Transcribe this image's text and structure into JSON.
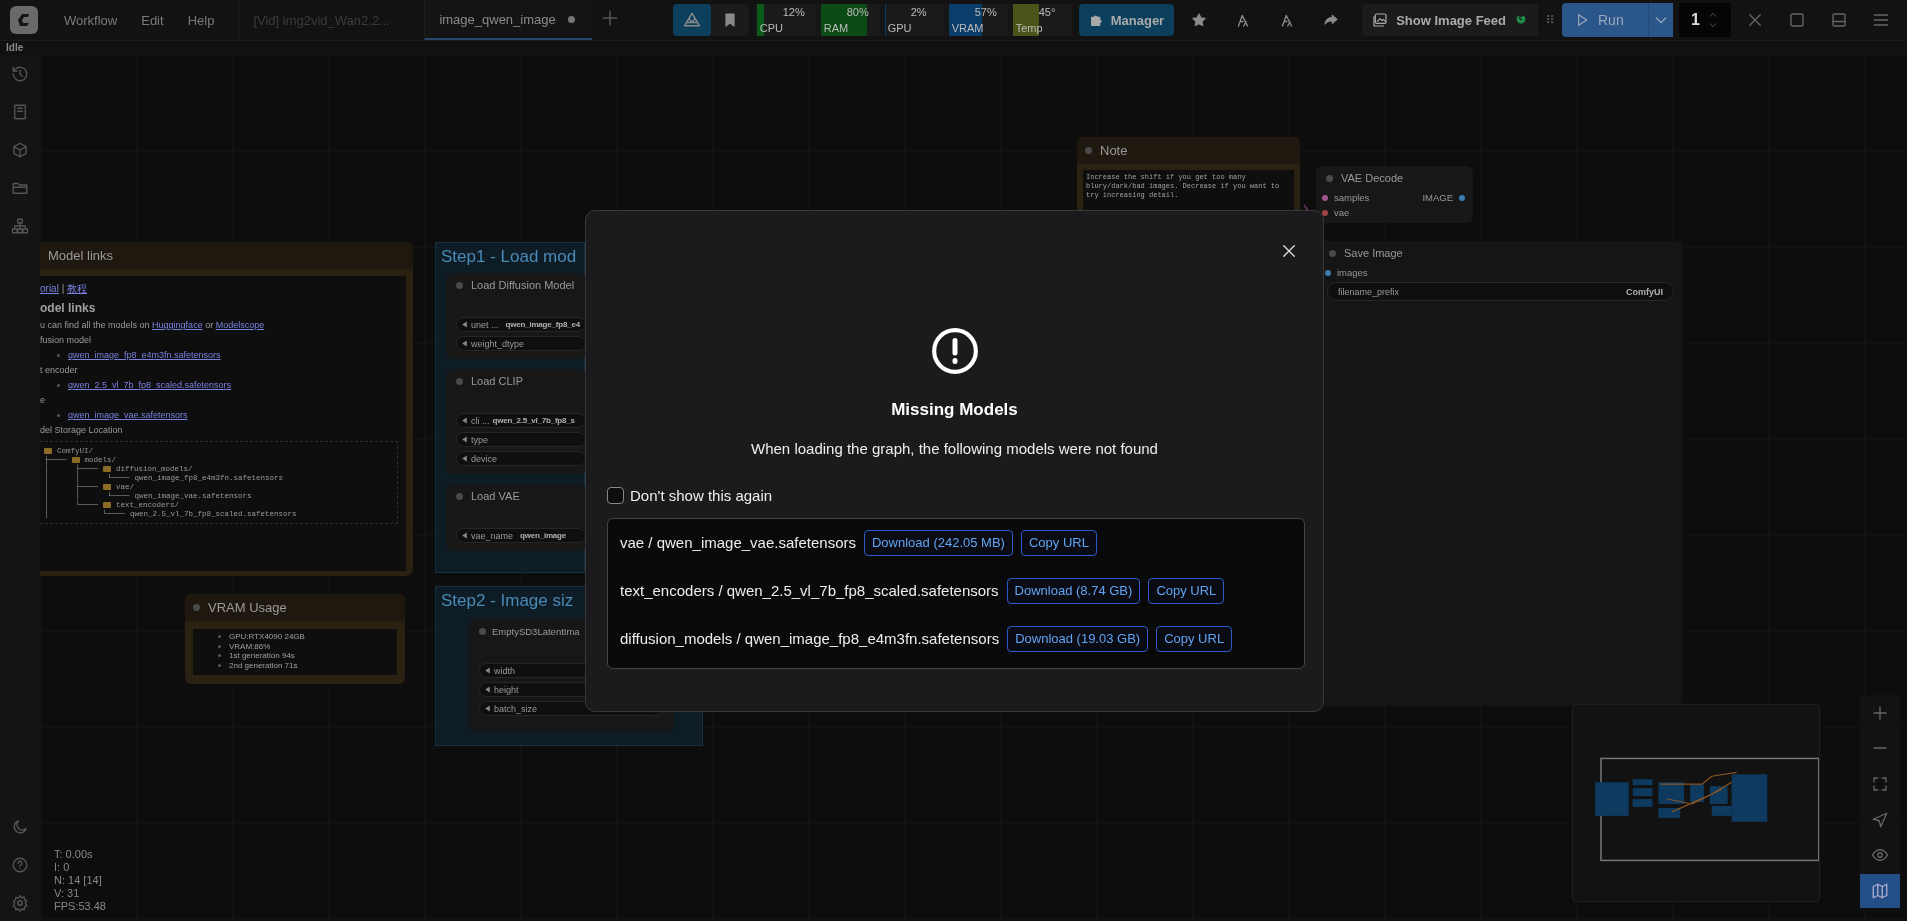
{
  "topbar": {
    "menus": [
      "Workflow",
      "Edit",
      "Help"
    ],
    "tabs": [
      {
        "label": "[Vid] img2vid_Wan2.2...",
        "selected": false,
        "unsaved": false
      },
      {
        "label": "image_qwen_image",
        "selected": true,
        "unsaved": true
      }
    ],
    "monitors": [
      {
        "label": "CPU",
        "value": "12%",
        "level": 0.12,
        "color": "#0c5a18"
      },
      {
        "label": "RAM",
        "value": "80%",
        "level": 0.8,
        "color": "#0a4a14"
      },
      {
        "label": "GPU",
        "value": "2%",
        "level": 0.02,
        "color": "#0b3d6a"
      },
      {
        "label": "VRAM",
        "value": "57%",
        "level": 0.57,
        "color": "#0b3d6a"
      },
      {
        "label": "Temp",
        "value": "45°",
        "level": 0.45,
        "color": "#4a5418"
      }
    ],
    "manager": "Manager",
    "image_feed": "Show Image Feed",
    "run": "Run",
    "batch_count": "1"
  },
  "status": "Idle",
  "model_links_node": {
    "title": "Model links",
    "body": [
      {
        "kind": "links",
        "links": [
          "orial",
          "教程"
        ],
        "separator": "|"
      },
      {
        "kind": "heading",
        "text": "odel links"
      },
      {
        "kind": "paragraph",
        "text": "u can find all the models on",
        "links": [
          "Huggingface",
          "Modelscope"
        ],
        "joiner": "or"
      },
      {
        "kind": "label",
        "text": "fusion model"
      },
      {
        "kind": "bullet",
        "text": "qwen_image_fp8_e4m3fn.safetensors"
      },
      {
        "kind": "label",
        "text": "t encoder"
      },
      {
        "kind": "bullet",
        "text": "qwen_2.5_vl_7b_fp8_scaled.safetensors"
      },
      {
        "kind": "label",
        "text": "e"
      },
      {
        "kind": "bullet",
        "text": "qwen_image_vae.safetensors"
      },
      {
        "kind": "label",
        "text": "del Storage Location"
      },
      {
        "kind": "tree",
        "lines": [
          {
            "folder": true,
            "name": "ComfyUI/"
          },
          {
            "branch": "├────",
            "folder": true,
            "name": "models/"
          },
          {
            "branch": "│      ├────",
            "folder": true,
            "name": "diffusion_models/"
          },
          {
            "branch": "│      │      └────",
            "folder": false,
            "name": "qwen_image_fp8_e4m3fn.safetensors"
          },
          {
            "branch": "│      ├────",
            "folder": true,
            "name": "vae/"
          },
          {
            "branch": "│      │      └────",
            "folder": false,
            "name": "qwen_image_vae.safetensors"
          },
          {
            "branch": "│      └────",
            "folder": true,
            "name": "text_encoders/"
          },
          {
            "branch": "│            └────",
            "folder": false,
            "name": "qwen_2.5_vl_7b_fp8_scaled.safetensors"
          }
        ]
      }
    ]
  },
  "groups": [
    {
      "title": "Step1 - Load mod",
      "nodes": [
        {
          "title": "Load Diffusion Model",
          "widgets": [
            {
              "label": "unet ...",
              "value": "qwen_image_fp8_e4"
            },
            {
              "label": "weight_dtype"
            }
          ]
        },
        {
          "title": "Load CLIP",
          "widgets": [
            {
              "label": "cli ...",
              "value": "qwen_2.5_vl_7b_fp8_s"
            },
            {
              "label": "type"
            },
            {
              "label": "device"
            }
          ]
        },
        {
          "title": "Load VAE",
          "widgets": [
            {
              "label": "vae_name",
              "value": "qwen_image"
            }
          ]
        }
      ]
    },
    {
      "title": "Step2 - Image siz",
      "nodes": [
        {
          "title": "EmptySD3LatentIma",
          "widgets": [
            {
              "label": "width"
            },
            {
              "label": "height"
            },
            {
              "label": "batch_size"
            }
          ]
        }
      ]
    }
  ],
  "vram_node": {
    "title": "VRAM Usage",
    "items": [
      "GPU:RTX4090 24GB",
      "VRAM:86%",
      "1st generation 94s",
      "2nd generation 71s"
    ]
  },
  "note_node": {
    "title": "Note",
    "text": "Increase the shift if you get too many blury/dark/bad images. Decrease if you want to try increasing detail."
  },
  "vae_decode_node": {
    "title": "VAE Decode",
    "inputs": [
      {
        "label": "samples",
        "color": "#a0558c"
      },
      {
        "label": "vae",
        "color": "#a04444"
      }
    ],
    "outputs": [
      {
        "label": "IMAGE",
        "color": "#3a7cae"
      }
    ]
  },
  "save_image_node": {
    "title": "Save Image",
    "inputs": [
      {
        "label": "images",
        "color": "#3a7cae"
      }
    ],
    "widgets": [
      {
        "label": "filename_prefix",
        "value": "ComfyUI"
      }
    ]
  },
  "stats": [
    "T: 0.00s",
    "I: 0",
    "N: 14 [14]",
    "V: 31",
    "FPS:53.48"
  ],
  "canvas_controls": [
    {
      "kind": "zoom_in",
      "selected": false
    },
    {
      "kind": "zoom_out",
      "selected": false
    },
    {
      "kind": "fit",
      "selected": false
    },
    {
      "kind": "locate",
      "selected": false
    },
    {
      "kind": "visibility",
      "selected": false
    },
    {
      "kind": "minimap",
      "selected": true
    }
  ],
  "dialog": {
    "title": "Missing Models",
    "message": "When loading the graph, the following models were not found",
    "dont_show": {
      "label": "Don't show this again",
      "checked": false
    },
    "models": [
      {
        "name": "vae / qwen_image_vae.safetensors",
        "download": "Download (242.05 MB)",
        "copy": "Copy URL"
      },
      {
        "name": "text_encoders / qwen_2.5_vl_7b_fp8_scaled.safetensors",
        "download": "Download (8.74 GB)",
        "copy": "Copy URL"
      },
      {
        "name": "diffusion_models / qwen_image_fp8_e4m3fn.safetensors",
        "download": "Download (19.03 GB)",
        "copy": "Copy URL"
      }
    ]
  }
}
